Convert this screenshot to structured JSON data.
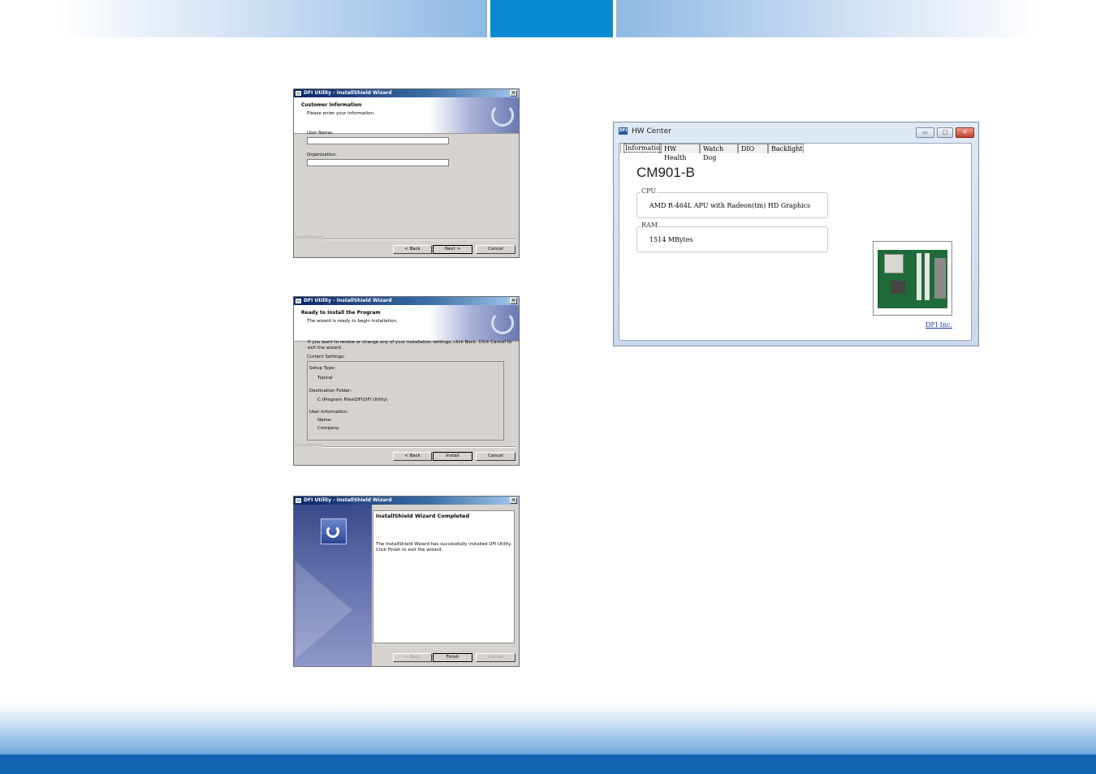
{
  "install_window_1": {
    "title": "DFI Utility - InstallShield Wizard",
    "heading": "Customer Information",
    "subheading": "Please enter your information.",
    "user_name_label": "User Name:",
    "user_name_value": "",
    "organization_label": "Organization:",
    "organization_value": "",
    "brand": "InstallShield",
    "back_label": "< Back",
    "next_label": "Next >",
    "cancel_label": "Cancel"
  },
  "install_window_2": {
    "title": "DFI Utility - InstallShield Wizard",
    "heading": "Ready to Install the Program",
    "subheading": "The wizard is ready to begin installation.",
    "instructions_line1": "If you want to review or change any of your installation settings, click Back. Click Cancel to",
    "instructions_line2": "exit the wizard.",
    "current_settings_label": "Current Settings:",
    "setup_type_label": "Setup Type:",
    "setup_type_value": "Typical",
    "destination_label": "Destination Folder:",
    "destination_value": "C:\\Program Files\\DFI\\DFI Utility\\",
    "user_info_label": "User Information:",
    "name_label": "Name:",
    "company_label": "Company:",
    "brand": "InstallShield",
    "back_label": "< Back",
    "install_label": "Install",
    "cancel_label": "Cancel"
  },
  "install_window_3": {
    "title": "DFI Utility - InstallShield Wizard",
    "heading": "InstallShield Wizard Completed",
    "message_line1": "The InstallShield Wizard has successfully installed DFI Utility.",
    "message_line2": "Click Finish to exit the wizard.",
    "back_label": "< Back",
    "finish_label": "Finish",
    "cancel_label": "Cancel"
  },
  "hw_center": {
    "app_icon_text": "DFI",
    "title": "HW Center",
    "tabs": [
      {
        "label": "Information"
      },
      {
        "label": "HW Health"
      },
      {
        "label": "Watch Dog"
      },
      {
        "label": "DIO"
      },
      {
        "label": "Backlight"
      }
    ],
    "active_tab": "Information",
    "model": "CM901-B",
    "cpu_label": "CPU",
    "cpu_value": "AMD R-464L APU with Radeon(tm) HD Graphics",
    "ram_label": "RAM",
    "ram_value": "1514 MBytes",
    "link_text": "DFI Inc.",
    "minimize_glyph": "▭",
    "maximize_glyph": "□",
    "close_glyph": "✕",
    "board_image": "motherboard-photo"
  },
  "icons": {
    "close": "close-icon",
    "app": "installshield-app-icon",
    "logo": "installshield-logo-icon"
  },
  "colors": {
    "header_accent": "#0a8ad0",
    "footer_bar": "#1266b4",
    "titlebar_start": "#0a246a",
    "link": "#1a3ab0"
  }
}
